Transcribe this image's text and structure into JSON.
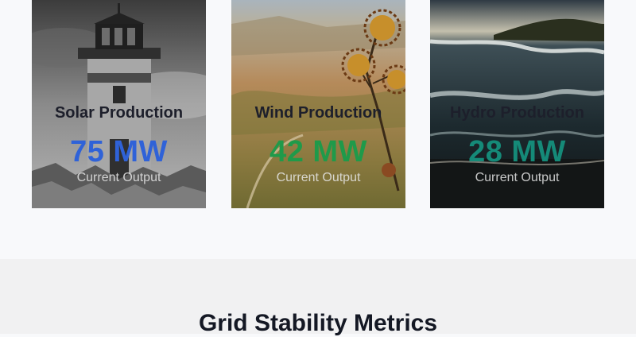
{
  "cards": [
    {
      "label": "Solar Production",
      "value": "75 MW",
      "sub": "Current Output",
      "color": "#2f62d8"
    },
    {
      "label": "Wind Production",
      "value": "42 MW",
      "sub": "Current Output",
      "color": "#1f9a4a"
    },
    {
      "label": "Hydro Production",
      "value": "28 MW",
      "sub": "Current Output",
      "color": "#158a78"
    }
  ],
  "section": {
    "title": "Grid Stability Metrics"
  }
}
